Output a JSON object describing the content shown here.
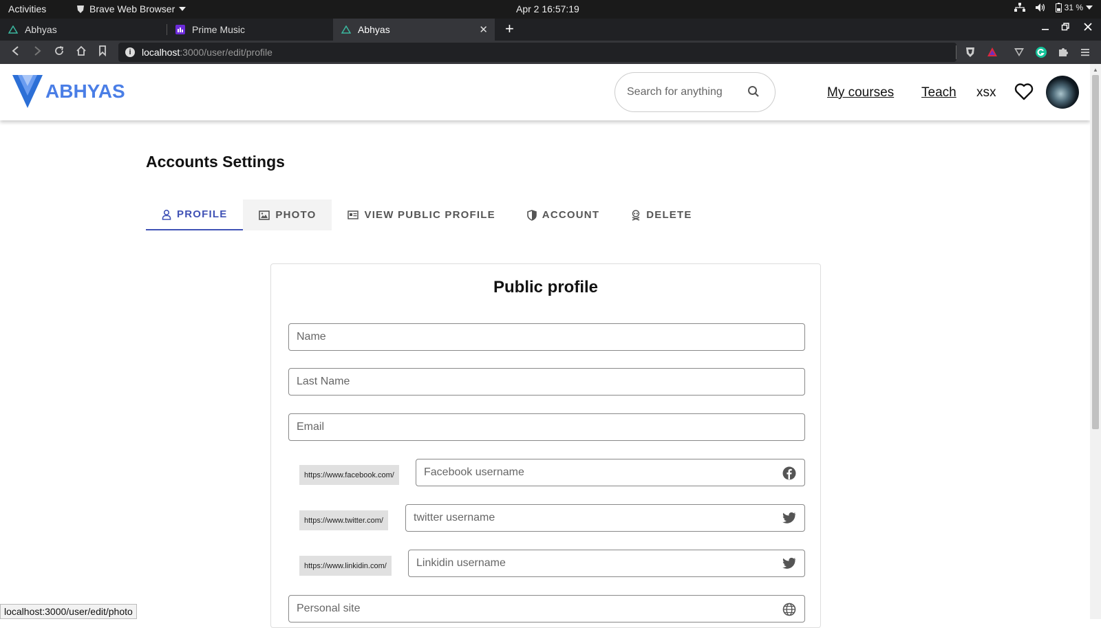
{
  "system": {
    "activities": "Activities",
    "app_name": "Brave Web Browser",
    "clock": "Apr 2  16:57:19",
    "battery": "31 %"
  },
  "browser": {
    "tabs": [
      {
        "label": "Abhyas"
      },
      {
        "label": "Prime Music"
      },
      {
        "label": "Abhyas"
      }
    ],
    "url_host": "localhost",
    "url_path": ":3000/user/edit/profile",
    "status_url": "localhost:3000/user/edit/photo"
  },
  "header": {
    "logo_text": "ABHYAS",
    "search_placeholder": "Search for anything",
    "nav": {
      "my_courses": "My courses",
      "teach": "Teach",
      "user": "xsx"
    }
  },
  "page": {
    "title": "Accounts Settings",
    "tabs": [
      {
        "label": "PROFILE",
        "icon": "user-icon",
        "active": true
      },
      {
        "label": "PHOTO",
        "icon": "image-icon"
      },
      {
        "label": "VIEW PUBLIC PROFILE",
        "icon": "id-card-icon"
      },
      {
        "label": "ACCOUNT",
        "icon": "shield-icon"
      },
      {
        "label": "DELETE",
        "icon": "skull-icon"
      }
    ],
    "card": {
      "title": "Public profile",
      "fields": {
        "name": "Name",
        "last_name": "Last Name",
        "email": "Email",
        "facebook_prefix": "https://www.facebook.com/",
        "facebook": "Facebook username",
        "twitter_prefix": "https://www.twitter.com/",
        "twitter": "twitter username",
        "linkedin_prefix": "https://www.linkidin.com/",
        "linkedin": "Linkidin username",
        "site": "Personal site"
      }
    }
  },
  "colors": {
    "brand": "#4a7ee6",
    "tab_active": "#3f51b5"
  }
}
